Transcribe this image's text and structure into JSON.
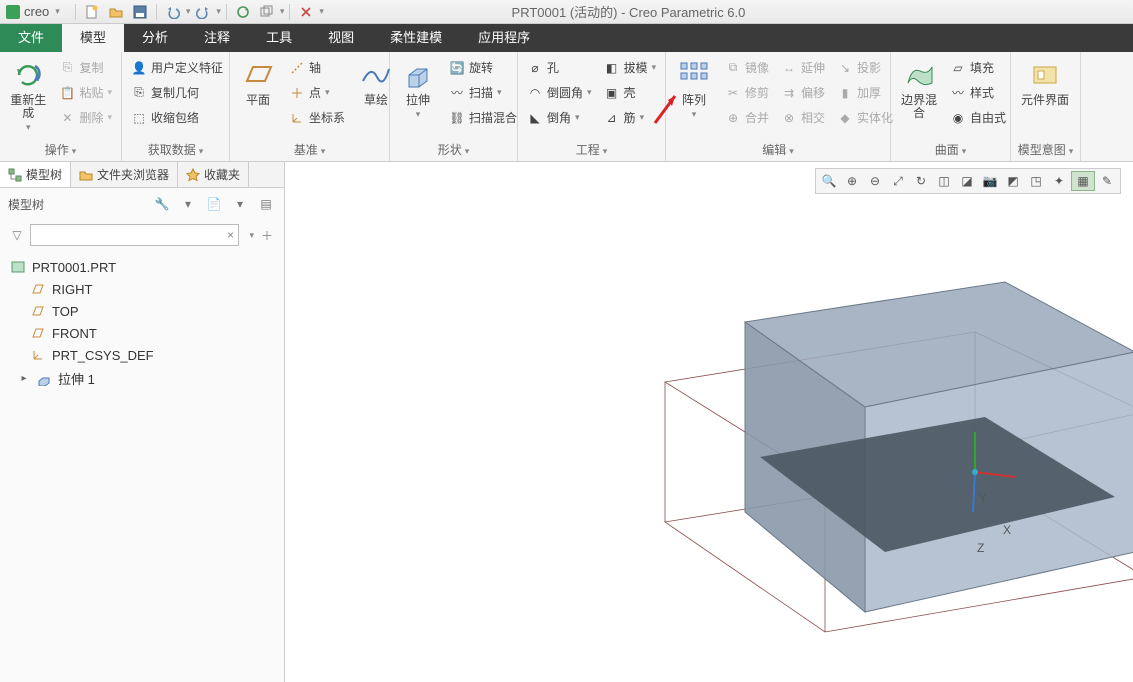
{
  "titlebar": {
    "logo": "creo",
    "window_title": "PRT0001 (活动的) - Creo Parametric 6.0"
  },
  "menutabs": {
    "file": "文件",
    "model": "模型",
    "analysis": "分析",
    "annotate": "注释",
    "tools": "工具",
    "view": "视图",
    "flex": "柔性建模",
    "app": "应用程序"
  },
  "ribbon": {
    "regenerate": "重新生成",
    "copy": "复制",
    "paste": "粘贴",
    "delete": "删除",
    "userfeature": "用户定义特征",
    "copygeom": "复制几何",
    "shrinkwrap": "收缩包络",
    "plane": "平面",
    "axis": "轴",
    "point": "点",
    "csys": "坐标系",
    "sketch": "草绘",
    "extrude": "拉伸",
    "revolve": "旋转",
    "sweep": "扫描",
    "sweepblend": "扫描混合",
    "hole": "孔",
    "round": "倒圆角",
    "chamfer": "倒角",
    "draft": "拔模",
    "shell": "壳",
    "rib": "筋",
    "pattern": "阵列",
    "mirror": "镜像",
    "trim": "修剪",
    "merge": "合并",
    "extend": "延伸",
    "offset": "偏移",
    "intersect": "相交",
    "project": "投影",
    "thicken": "加厚",
    "solidify": "实体化",
    "boundary": "边界混合",
    "fill": "填充",
    "style": "样式",
    "freeform": "自由式",
    "compif": "元件界面",
    "groups": {
      "ops": "操作",
      "getdata": "获取数据",
      "datum": "基准",
      "shapes": "形状",
      "eng": "工程",
      "edit": "编辑",
      "surface": "曲面",
      "intent": "模型意图"
    }
  },
  "sidebar": {
    "tabs": {
      "modeltree": "模型树",
      "folderbrowser": "文件夹浏览器",
      "favorites": "收藏夹"
    },
    "header": "模型树",
    "search_placeholder": "",
    "tree": {
      "root": "PRT0001.PRT",
      "right": "RIGHT",
      "top": "TOP",
      "front": "FRONT",
      "csys": "PRT_CSYS_DEF",
      "extrude1": "拉伸 1"
    }
  },
  "viewport": {
    "axes": {
      "x": "X",
      "y": "Y",
      "z": "Z"
    }
  }
}
